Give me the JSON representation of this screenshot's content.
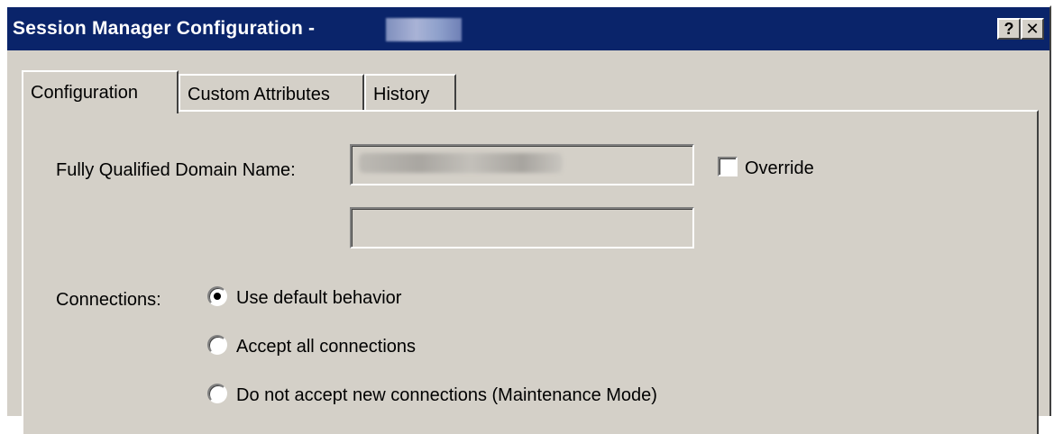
{
  "window": {
    "title": "Session Manager Configuration -",
    "help_label": "?",
    "close_label": "✕"
  },
  "tabs": [
    {
      "label": "Configuration",
      "active": true
    },
    {
      "label": "Custom Attributes",
      "active": false
    },
    {
      "label": "History",
      "active": false
    }
  ],
  "form": {
    "fqdn_label": "Fully Qualified Domain Name:",
    "override_label": "Override",
    "override_checked": false,
    "connections_label": "Connections:",
    "connection_options": [
      {
        "label": "Use default behavior",
        "selected": true
      },
      {
        "label": "Accept all connections",
        "selected": false
      },
      {
        "label": "Do not accept new connections (Maintenance Mode)",
        "selected": false
      }
    ]
  },
  "colors": {
    "titlebar": "#0a246a",
    "dialog_face": "#d4d0c8"
  }
}
